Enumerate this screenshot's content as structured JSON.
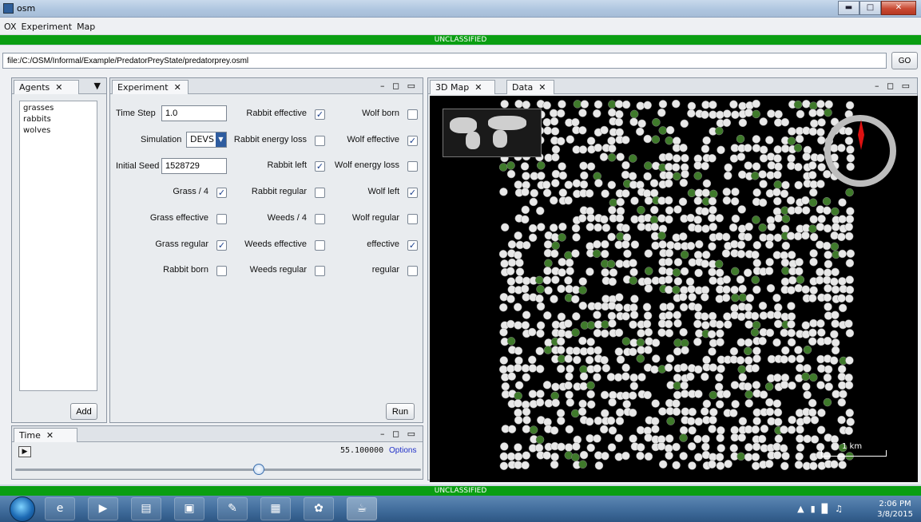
{
  "window": {
    "title": "osm"
  },
  "menu": [
    "OX",
    "Experiment",
    "Map"
  ],
  "banner": {
    "text": "UNCLASSIFIED",
    "color": "#0a9e12"
  },
  "url_bar": {
    "value": "file:/C:/OSM/Informal/Example/PredatorPreyState/predatorprey.osml",
    "go_label": "GO"
  },
  "agents_panel": {
    "tab_label": "Agents",
    "items": [
      "grasses",
      "rabbits",
      "wolves"
    ],
    "add_label": "Add"
  },
  "experiment_panel": {
    "tab_label": "Experiment",
    "time_step_label": "Time Step",
    "time_step_value": "1.0",
    "simulation_label": "Simulation",
    "simulation_value": "DEVS",
    "initial_seed_label": "Initial Seed",
    "initial_seed_value": "1528729",
    "checkboxes": [
      {
        "label": "Grass / 4",
        "checked": true
      },
      {
        "label": "Grass effective",
        "checked": false
      },
      {
        "label": "Grass regular",
        "checked": true
      },
      {
        "label": "Rabbit born",
        "checked": false
      },
      {
        "label": "Rabbit effective",
        "checked": true
      },
      {
        "label": "Rabbit energy loss",
        "checked": false
      },
      {
        "label": "Rabbit left",
        "checked": true
      },
      {
        "label": "Rabbit regular",
        "checked": false
      },
      {
        "label": "Weeds / 4",
        "checked": false
      },
      {
        "label": "Weeds effective",
        "checked": false
      },
      {
        "label": "Weeds regular",
        "checked": false
      },
      {
        "label": "Wolf born",
        "checked": false
      },
      {
        "label": "Wolf effective",
        "checked": true
      },
      {
        "label": "Wolf energy loss",
        "checked": false
      },
      {
        "label": "Wolf left",
        "checked": true
      },
      {
        "label": "Wolf regular",
        "checked": false
      },
      {
        "label": "effective",
        "checked": true
      },
      {
        "label": "regular",
        "checked": false
      }
    ],
    "run_label": "Run"
  },
  "time_panel": {
    "tab_label": "Time",
    "time_value": "55.100000",
    "options_label": "Options",
    "slider_fraction": 0.6
  },
  "map_panel": {
    "tabs": [
      "3D Map",
      "Data"
    ],
    "scale_label": "1 km"
  },
  "taskbar": {
    "time": "2:06 PM",
    "date": "3/8/2015"
  }
}
